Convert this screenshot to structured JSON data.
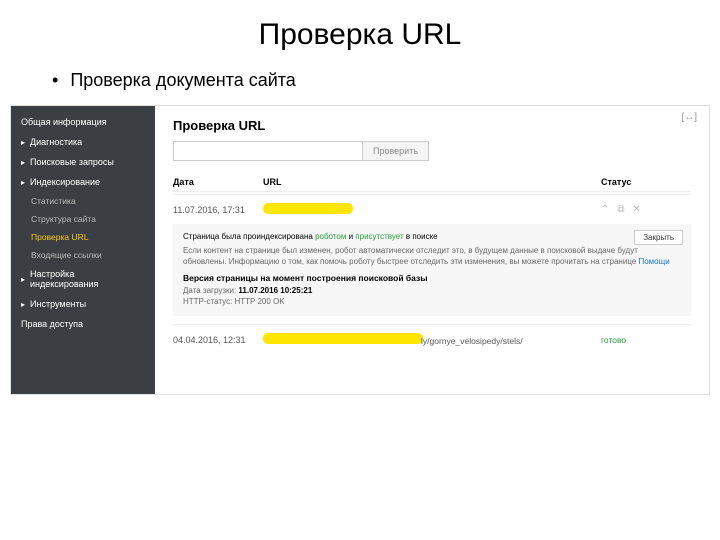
{
  "slide": {
    "title": "Проверка URL",
    "bullet": "Проверка документа сайта"
  },
  "sidebar": {
    "items": [
      {
        "label": "Общая информация",
        "expandable": false
      },
      {
        "label": "Диагностика",
        "expandable": true
      },
      {
        "label": "Поисковые запросы",
        "expandable": true
      },
      {
        "label": "Индексирование",
        "expandable": true
      },
      {
        "label": "Настройка индексирования",
        "expandable": true
      },
      {
        "label": "Инструменты",
        "expandable": true
      },
      {
        "label": "Права доступа",
        "expandable": false
      }
    ],
    "subs": [
      {
        "label": "Статистика"
      },
      {
        "label": "Структура сайта"
      },
      {
        "label": "Проверка URL",
        "active": true
      },
      {
        "label": "Входящие ссылки"
      }
    ]
  },
  "main": {
    "heading": "Проверка URL",
    "input_placeholder": "",
    "check_btn": "Проверить",
    "columns": {
      "date": "Дата",
      "url": "URL",
      "status": "Статус"
    },
    "row1": {
      "date": "11.07.2016, 17:31"
    },
    "detail": {
      "line1_a": "Страница была проиндексирована",
      "line1_b": "роботом",
      "line1_c": "и",
      "line1_d": "присутствует",
      "line1_e": "в поиске",
      "desc_a": "Если контент на странице был изменен, робот автоматически отследит это, в будущем данные в поисковой выдаче будут обновлены. Информацию о том, как помочь роботу быстрее отследить эти изменения, вы можете прочитать на странице ",
      "desc_link": "Помощи",
      "strong": "Версия страницы на момент построения поисковой базы",
      "meta1_label": "Дата загрузки: ",
      "meta1_value": "11.07.2016 10:25:21",
      "meta2": "HTTP-статус: HTTP 200 OK",
      "close": "Закрыть"
    },
    "row3": {
      "date": "04.04.2016, 12:31",
      "url_tail": "ly/gornye_velosipedy/stels/",
      "status": "готово"
    }
  }
}
